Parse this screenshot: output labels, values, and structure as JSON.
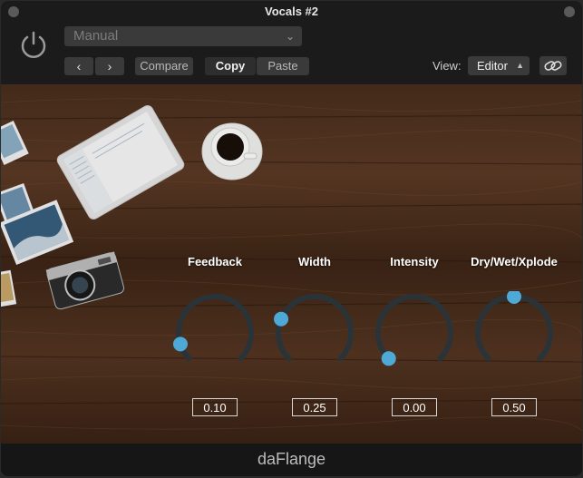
{
  "window": {
    "title": "Vocals #2"
  },
  "header": {
    "preset": "Manual",
    "nav_prev": "‹",
    "nav_next": "›",
    "compare_label": "Compare",
    "copy_label": "Copy",
    "paste_label": "Paste",
    "view_label": "View:",
    "view_value": "Editor"
  },
  "plugin": {
    "name": "daFlange",
    "knobs": [
      {
        "label": "Feedback",
        "value": "0.10",
        "level": 0.1
      },
      {
        "label": "Width",
        "value": "0.25",
        "level": 0.25
      },
      {
        "label": "Intensity",
        "value": "0.00",
        "level": 0.0
      },
      {
        "label": "Dry/Wet/Xplode",
        "value": "0.50",
        "level": 0.5
      }
    ]
  },
  "colors": {
    "knob_track": "#2a3438",
    "knob_handle": "#4fa9d6",
    "wood_dark": "#3b2416",
    "wood_light": "#6a452c"
  },
  "icons": [
    "power-icon",
    "chevron-left-icon",
    "chevron-right-icon",
    "chevron-down-icon",
    "updown-icon",
    "link-icon"
  ]
}
